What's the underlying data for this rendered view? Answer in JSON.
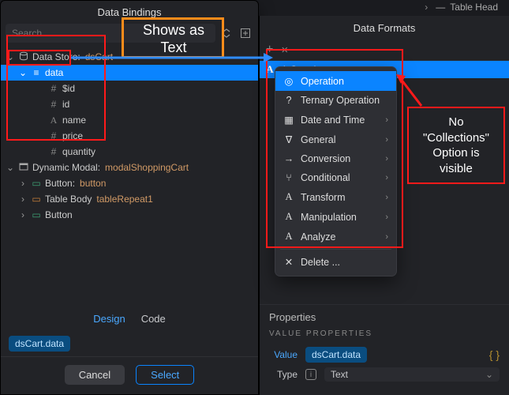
{
  "colors": {
    "accent": "#0a84ff",
    "warn": "#ff1a1a",
    "orange": "#ff8c1a"
  },
  "top_right_item": "Table Head",
  "left": {
    "title": "Data Bindings",
    "search_placeholder": "Search",
    "tree": {
      "datastore": {
        "label": "Data Store:",
        "name": "dsCart"
      },
      "data": "data",
      "fields": [
        "$id",
        "id",
        "name",
        "price",
        "quantity"
      ],
      "modal": {
        "label": "Dynamic Modal:",
        "name": "modalShoppingCart"
      },
      "children": [
        {
          "label": "Button:",
          "name": "button"
        },
        {
          "label": "Table Body",
          "name": "tableRepeat1"
        },
        {
          "label": "Button",
          "name": ""
        }
      ]
    },
    "design_label": "Design",
    "code_label": "Code",
    "chip": "dsCart.data",
    "cancel": "Cancel",
    "select": "Select"
  },
  "annotations": {
    "shows_as_text": "Shows as\nText",
    "no_collections_1": "No \"Collections\"",
    "no_collections_2": "Option is visible"
  },
  "right": {
    "title": "Data Formats",
    "plus": "+",
    "close": "×",
    "expression": "dsCart.data",
    "menu": [
      {
        "icon": "target",
        "label": "Operation",
        "sub": false,
        "sel": true
      },
      {
        "icon": "question",
        "label": "Ternary Operation",
        "sub": false
      },
      {
        "icon": "calendar",
        "label": "Date and Time",
        "sub": true
      },
      {
        "icon": "filter",
        "label": "General",
        "sub": true
      },
      {
        "icon": "arrow",
        "label": "Conversion",
        "sub": true
      },
      {
        "icon": "branch",
        "label": "Conditional",
        "sub": true
      },
      {
        "icon": "A",
        "label": "Transform",
        "sub": true
      },
      {
        "icon": "A",
        "label": "Manipulation",
        "sub": true
      },
      {
        "icon": "A",
        "label": "Analyze",
        "sub": true
      },
      {
        "icon": "x",
        "label": "Delete ...",
        "sub": false,
        "sep_before": true
      }
    ],
    "props": {
      "section": "Properties",
      "group": "VALUE PROPERTIES",
      "value_label": "Value",
      "value_chip": "dsCart.data",
      "type_label": "Type",
      "type_value": "Text"
    }
  }
}
